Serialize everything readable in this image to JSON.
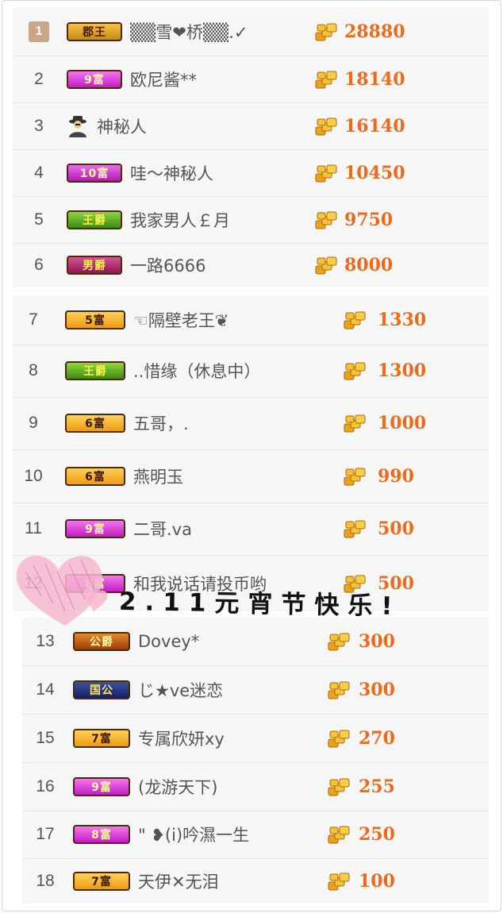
{
  "section1": {
    "rows": [
      {
        "rank": "1",
        "badge": "郡王",
        "badge_class": "b-jun",
        "name": "▒▒雪❤桥▒▒.✓",
        "score": "28880"
      },
      {
        "rank": "2",
        "badge": "9富",
        "badge_class": "b-9fu",
        "name": "欧尼酱**",
        "score": "18140"
      },
      {
        "rank": "3",
        "badge": "",
        "badge_class": "",
        "icon": "mystery-person-icon",
        "name": "神秘人",
        "score": "16140"
      },
      {
        "rank": "4",
        "badge": "10富",
        "badge_class": "b-10fu",
        "name": "哇～神秘人",
        "score": "10450"
      },
      {
        "rank": "5",
        "badge": "王爵",
        "badge_class": "b-wang",
        "name": "我家男人￡月",
        "score": "9750"
      },
      {
        "rank": "6",
        "badge": "男爵",
        "badge_class": "b-nan",
        "name": "一路6666",
        "score": "8000"
      }
    ]
  },
  "section2": {
    "rows": [
      {
        "rank": "7",
        "badge": "5富",
        "badge_class": "b-5fu",
        "name": "☜隔壁老王❦",
        "score": "1330"
      },
      {
        "rank": "8",
        "badge": "王爵",
        "badge_class": "b-wang",
        "name": "..惜缘（休息中）",
        "score": "1300"
      },
      {
        "rank": "9",
        "badge": "6富",
        "badge_class": "b-6fu",
        "name": "五哥，.",
        "score": "1000"
      },
      {
        "rank": "10",
        "badge": "6富",
        "badge_class": "b-6fu",
        "name": "燕明玉",
        "score": "990"
      },
      {
        "rank": "11",
        "badge": "9富",
        "badge_class": "b-9fu",
        "name": "二哥.va",
        "score": "500"
      },
      {
        "rank": "12",
        "badge": "8富",
        "badge_class": "b-8fu",
        "name": "和我说话请投币哟",
        "score": "500"
      }
    ]
  },
  "section3": {
    "rows": [
      {
        "rank": "13",
        "badge": "公爵",
        "badge_class": "b-gong",
        "name": "Dovey*",
        "score": "300"
      },
      {
        "rank": "14",
        "badge": "国公",
        "badge_class": "b-guogong",
        "name": "じ★ve迷恋",
        "score": "300"
      },
      {
        "rank": "15",
        "badge": "7富",
        "badge_class": "b-7fu",
        "name": "专属欣妍xy",
        "score": "270"
      },
      {
        "rank": "16",
        "badge": "9富",
        "badge_class": "b-9fu",
        "name": "(龙游天下)",
        "score": "255"
      },
      {
        "rank": "17",
        "badge": "8富",
        "badge_class": "b-8fu",
        "name": "\" ❥(i)吟濕一生",
        "score": "250"
      },
      {
        "rank": "18",
        "badge": "7富",
        "badge_class": "b-7fu",
        "name": "天伊✕无泪",
        "score": "100"
      }
    ]
  },
  "overlay": {
    "text": "2.11元宵节快乐!"
  },
  "colors": {
    "score": "#ee6a1a",
    "coin": "#f2b630",
    "background": "#f6f6f6"
  }
}
